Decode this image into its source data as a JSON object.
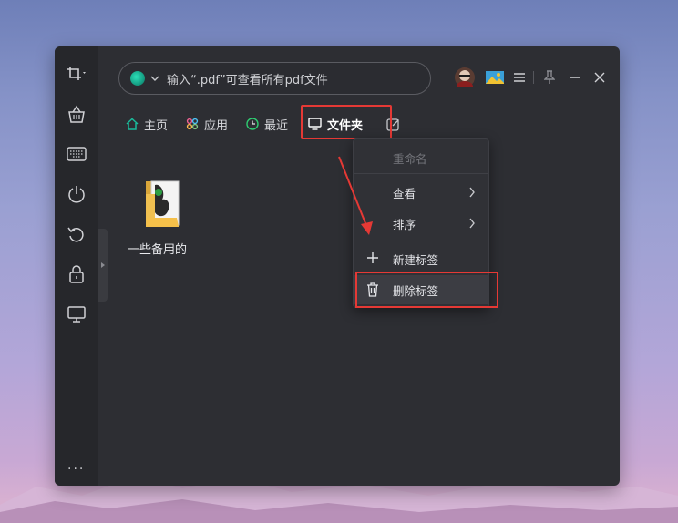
{
  "search": {
    "placeholder": "输入“.pdf”可查看所有pdf文件"
  },
  "tabs": [
    {
      "label": "主页",
      "icon": "home-icon"
    },
    {
      "label": "应用",
      "icon": "apps-icon"
    },
    {
      "label": "最近",
      "icon": "clock-icon"
    },
    {
      "label": "文件夹",
      "icon": "monitor-icon",
      "active": true
    }
  ],
  "folder": {
    "label": "一些备用的"
  },
  "context_menu": {
    "items": [
      {
        "label": "重命名",
        "disabled": true
      },
      {
        "label": "查看",
        "submenu": true
      },
      {
        "label": "排序",
        "submenu": true
      },
      {
        "label": "新建标签",
        "icon": "plus-icon"
      },
      {
        "label": "删除标签",
        "icon": "trash-icon",
        "hovered": true
      }
    ]
  },
  "sidebar": {
    "icons": [
      "crop-icon",
      "basket-icon",
      "keyboard-icon",
      "power-icon",
      "undo-icon",
      "lock-icon",
      "monitor-icon"
    ],
    "more_label": "..."
  },
  "colors": {
    "highlight_red": "#e53935",
    "window_bg": "#2d2e33",
    "accent_green": "#16a085"
  }
}
